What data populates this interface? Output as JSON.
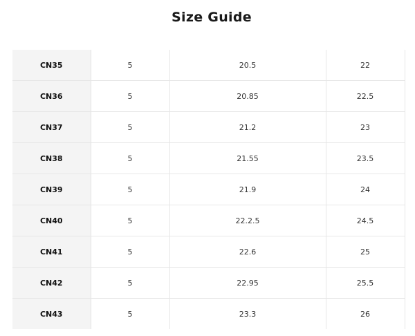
{
  "title": "Size Guide",
  "rows": [
    {
      "size": "CN35",
      "col2": "5",
      "col3": "20.5",
      "col4": "22"
    },
    {
      "size": "CN36",
      "col2": "5",
      "col3": "20.85",
      "col4": "22.5"
    },
    {
      "size": "CN37",
      "col2": "5",
      "col3": "21.2",
      "col4": "23"
    },
    {
      "size": "CN38",
      "col2": "5",
      "col3": "21.55",
      "col4": "23.5"
    },
    {
      "size": "CN39",
      "col2": "5",
      "col3": "21.9",
      "col4": "24"
    },
    {
      "size": "CN40",
      "col2": "5",
      "col3": "22.2.5",
      "col4": "24.5"
    },
    {
      "size": "CN41",
      "col2": "5",
      "col3": "22.6",
      "col4": "25"
    },
    {
      "size": "CN42",
      "col2": "5",
      "col3": "22.95",
      "col4": "25.5"
    },
    {
      "size": "CN43",
      "col2": "5",
      "col3": "23.3",
      "col4": "26"
    }
  ]
}
